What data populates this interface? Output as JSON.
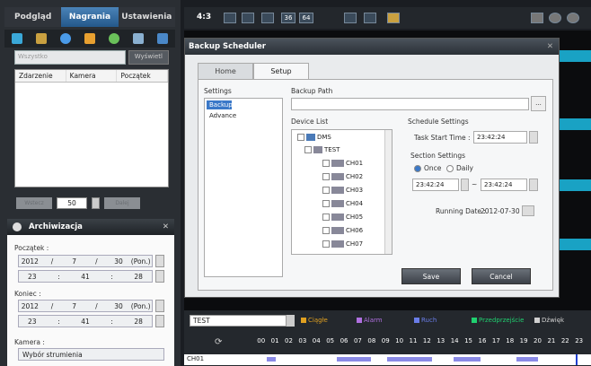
{
  "left": {
    "tabs": [
      "Podgląd",
      "Nagrania",
      "Ustawienia"
    ],
    "active_tab": "Nagrania",
    "filter": {
      "value": "Wszystko",
      "button": "Wyświetl"
    },
    "event_table": {
      "columns": [
        "Zdarzenie",
        "Kamera",
        "Początek"
      ]
    },
    "pager": {
      "count": "50",
      "prev": "Wstecz",
      "next": "Dalej"
    },
    "archive": {
      "title": "Archiwizacja",
      "start_label": "Początek :",
      "start_date": [
        "2012",
        "/",
        "7",
        "/",
        "30",
        "(Pon.)"
      ],
      "start_time": [
        "23",
        ":",
        "41",
        ":",
        "28"
      ],
      "end_label": "Koniec :",
      "end_date": [
        "2012",
        "/",
        "7",
        "/",
        "30",
        "(Pon.)"
      ],
      "end_time": [
        "23",
        ":",
        "41",
        ":",
        "28"
      ],
      "camera_label": "Kamera :",
      "camera_value": "Wybór strumienia"
    }
  },
  "toolbar": {
    "ratio": "4:3",
    "grid36": "36",
    "grid64": "64"
  },
  "dialog": {
    "title": "Backup Scheduler",
    "tabs": [
      "Home",
      "Setup"
    ],
    "active_tab": "Setup",
    "settings": {
      "label": "Settings",
      "items": [
        "Backup",
        "Advance"
      ],
      "selected": "Backup"
    },
    "backup_path": {
      "label": "Backup Path",
      "value": "",
      "browse": "..."
    },
    "device_list": {
      "label": "Device List",
      "root": "DMS",
      "group": "TEST",
      "channels": [
        "CH01",
        "CH02",
        "CH03",
        "CH04",
        "CH05",
        "CH06",
        "CH07"
      ]
    },
    "schedule": {
      "label": "Schedule Settings",
      "start_label": "Task Start Time :",
      "start_value": "23:42:24"
    },
    "section": {
      "label": "Section Settings",
      "once": "Once",
      "daily": "Daily",
      "from": "23:42:24",
      "sep": "~",
      "to": "23:42:24",
      "running_label": "Running Date :",
      "running_value": "2012-07-30"
    },
    "save": "Save",
    "cancel": "Cancel"
  },
  "bottom": {
    "group": "TEST",
    "legend": [
      {
        "label": "Ciągłe",
        "color": "#e0a020"
      },
      {
        "label": "Alarm",
        "color": "#b070e0"
      },
      {
        "label": "Ruch",
        "color": "#6a7de8"
      },
      {
        "label": "Przedprzejście",
        "color": "#20d070"
      },
      {
        "label": "Dźwięk",
        "color": "#d0d0d0"
      }
    ],
    "hours": [
      "00",
      "01",
      "02",
      "03",
      "04",
      "05",
      "06",
      "07",
      "08",
      "09",
      "10",
      "11",
      "12",
      "13",
      "14",
      "15",
      "16",
      "17",
      "18",
      "19",
      "20",
      "21",
      "22",
      "23"
    ],
    "channel": "CH01"
  }
}
